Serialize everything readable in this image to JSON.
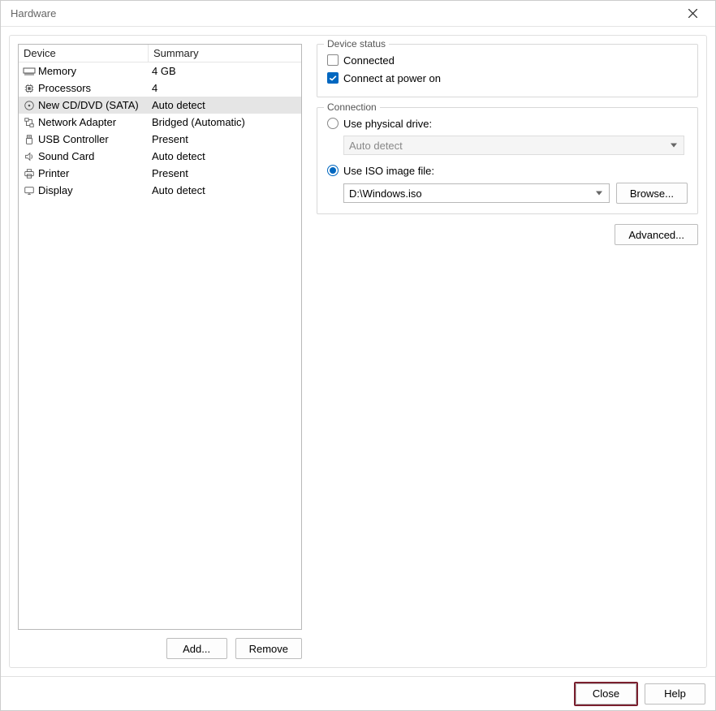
{
  "window": {
    "title": "Hardware"
  },
  "deviceList": {
    "header": {
      "device": "Device",
      "summary": "Summary"
    },
    "rows": [
      {
        "icon": "memory-icon",
        "name": "Memory",
        "summary": "4 GB",
        "selected": false
      },
      {
        "icon": "cpu-icon",
        "name": "Processors",
        "summary": "4",
        "selected": false
      },
      {
        "icon": "disc-icon",
        "name": "New CD/DVD (SATA)",
        "summary": "Auto detect",
        "selected": true
      },
      {
        "icon": "network-icon",
        "name": "Network Adapter",
        "summary": "Bridged (Automatic)",
        "selected": false
      },
      {
        "icon": "usb-icon",
        "name": "USB Controller",
        "summary": "Present",
        "selected": false
      },
      {
        "icon": "sound-icon",
        "name": "Sound Card",
        "summary": "Auto detect",
        "selected": false
      },
      {
        "icon": "printer-icon",
        "name": "Printer",
        "summary": "Present",
        "selected": false
      },
      {
        "icon": "display-icon",
        "name": "Display",
        "summary": "Auto detect",
        "selected": false
      }
    ]
  },
  "leftButtons": {
    "add": "Add...",
    "remove": "Remove"
  },
  "status": {
    "legend": "Device status",
    "connected": {
      "label": "Connected",
      "checked": false
    },
    "connectPowerOn": {
      "label": "Connect at power on",
      "checked": true
    }
  },
  "connection": {
    "legend": "Connection",
    "physical": {
      "label": "Use physical drive:",
      "selected": false,
      "value": "Auto detect"
    },
    "iso": {
      "label": "Use ISO image file:",
      "selected": true,
      "value": "D:\\Windows.iso"
    },
    "browse": "Browse..."
  },
  "advanced": "Advanced...",
  "footer": {
    "close": "Close",
    "help": "Help"
  }
}
